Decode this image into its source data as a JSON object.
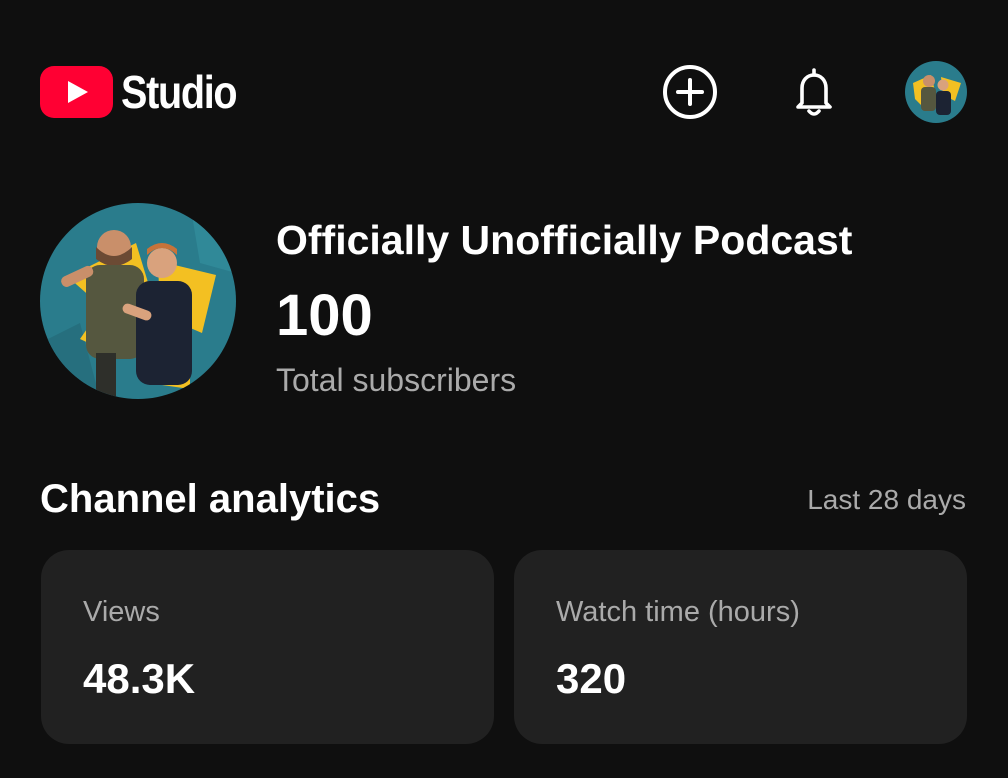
{
  "app": {
    "logo_text": "Studio",
    "brand_color": "#ff0033",
    "icons": {
      "create": "add-circle-icon",
      "notifications": "bell-icon",
      "account": "account-avatar"
    }
  },
  "channel": {
    "name": "Officially Unofficially Podcast",
    "subscriber_count": "100",
    "subscriber_label": "Total subscribers"
  },
  "analytics": {
    "title": "Channel analytics",
    "period": "Last 28 days",
    "cards": [
      {
        "label": "Views",
        "value": "48.3K"
      },
      {
        "label": "Watch time (hours)",
        "value": "320"
      }
    ]
  },
  "colors": {
    "background": "#0f0f0f",
    "card": "#212121",
    "secondary_text": "#aaaaaa",
    "avatar_bg": "#2a7c8c",
    "avatar_accent": "#f3c022"
  }
}
